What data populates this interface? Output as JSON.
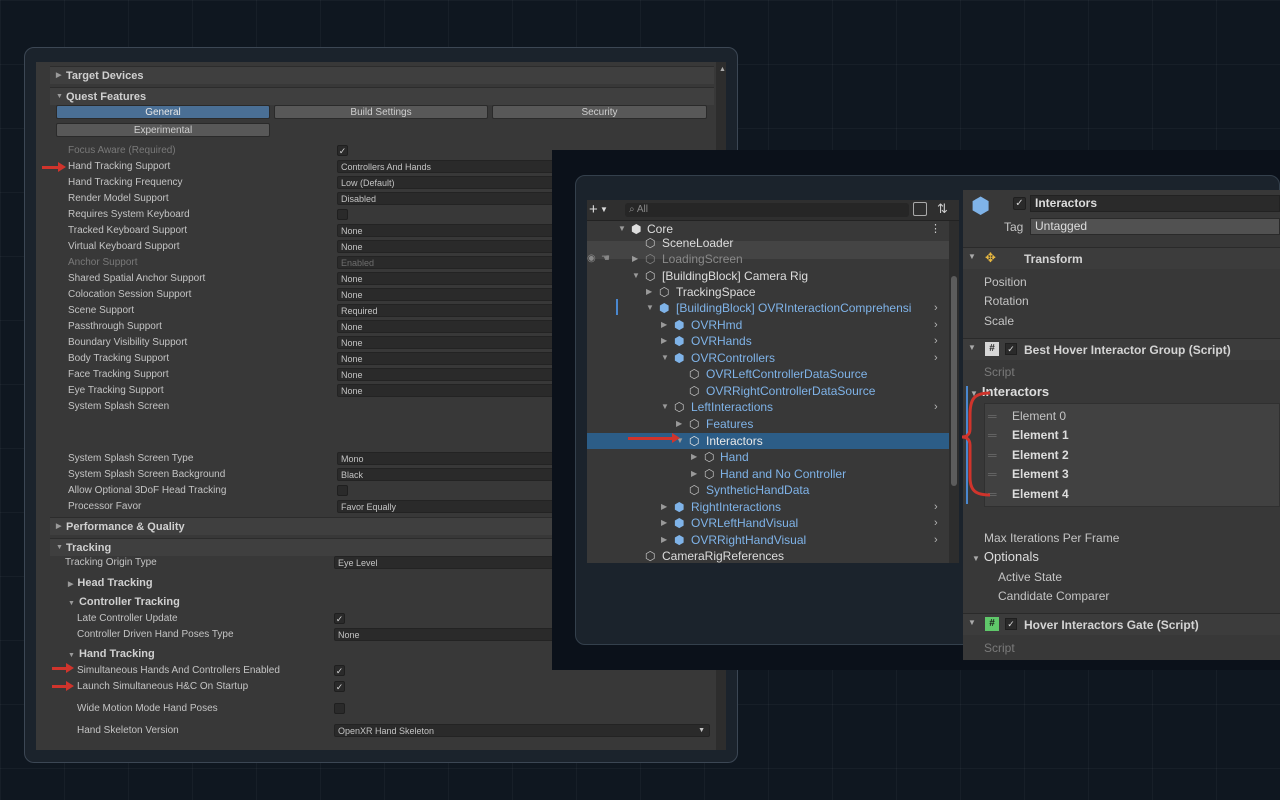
{
  "left": {
    "sections": {
      "target_devices": "Target Devices",
      "quest_features": "Quest Features",
      "performance": "Performance & Quality",
      "tracking": "Tracking"
    },
    "tabs": [
      "General",
      "Build Settings",
      "Security",
      "Experimental"
    ],
    "rows": [
      {
        "label": "Focus Aware (Required)",
        "check": "✓"
      },
      {
        "label": "Hand Tracking Support",
        "value": "Controllers And Hands"
      },
      {
        "label": "Hand Tracking Frequency",
        "value": "Low (Default)"
      },
      {
        "label": "Render Model Support",
        "value": "Disabled"
      },
      {
        "label": "Requires System Keyboard",
        "check": ""
      },
      {
        "label": "Tracked Keyboard Support",
        "value": "None"
      },
      {
        "label": "Virtual Keyboard Support",
        "value": "None"
      },
      {
        "label": "Anchor Support",
        "value": "Enabled"
      },
      {
        "label": "Shared Spatial Anchor Support",
        "value": "None"
      },
      {
        "label": "Colocation Session Support",
        "value": "None"
      },
      {
        "label": "Scene Support",
        "value": "Required"
      },
      {
        "label": "Passthrough Support",
        "value": "None"
      },
      {
        "label": "Boundary Visibility Support",
        "value": "None"
      },
      {
        "label": "Body Tracking Support",
        "value": "None"
      },
      {
        "label": "Face Tracking Support",
        "value": "None"
      },
      {
        "label": "Eye Tracking Support",
        "value": "None"
      },
      {
        "label": "System Splash Screen"
      },
      {
        "label": "System Splash Screen Type",
        "value": "Mono"
      },
      {
        "label": "System Splash Screen Background",
        "value": "Black"
      },
      {
        "label": "Allow Optional 3DoF Head Tracking",
        "check": ""
      },
      {
        "label": "Processor Favor",
        "value": "Favor Equally"
      }
    ],
    "tracking": {
      "origin_label": "Tracking Origin Type",
      "origin_value": "Eye Level",
      "head_tracking": "Head Tracking",
      "controller_tracking": "Controller Tracking",
      "late_update": "Late Controller Update",
      "late_update_check": "✓",
      "hand_poses": "Controller Driven Hand Poses Type",
      "hand_poses_value": "None",
      "hand_tracking": "Hand Tracking",
      "simul": "Simultaneous Hands And Controllers Enabled",
      "simul_check": "✓",
      "launch": "Launch Simultaneous H&C On Startup",
      "launch_check": "✓",
      "wide": "Wide Motion Mode Hand Poses",
      "wide_check": "",
      "skeleton": "Hand Skeleton Version",
      "skeleton_value": "OpenXR Hand Skeleton"
    }
  },
  "hierarchy": {
    "search_placeholder": "All",
    "add": "+",
    "items": [
      "Core",
      "SceneLoader",
      "LoadingScreen",
      "[BuildingBlock] Camera Rig",
      "TrackingSpace",
      "[BuildingBlock] OVRInteractionComprehensi",
      "OVRHmd",
      "OVRHands",
      "OVRControllers",
      "OVRLeftControllerDataSource",
      "OVRRightControllerDataSource",
      "LeftInteractions",
      "Features",
      "Interactors",
      "Hand",
      "Hand and No Controller",
      "SyntheticHandData",
      "RightInteractions",
      "OVRLeftHandVisual",
      "OVRRightHandVisual",
      "CameraRigReferences"
    ]
  },
  "inspector": {
    "object_name": "Interactors",
    "tag_label": "Tag",
    "tag_value": "Untagged",
    "transform": "Transform",
    "position": "Position",
    "rotation": "Rotation",
    "scale": "Scale",
    "best_hover": "Best Hover Interactor Group (Script)",
    "script": "Script",
    "interactors": "Interactors",
    "elements": [
      "Element 0",
      "Element 1",
      "Element 2",
      "Element 3",
      "Element 4"
    ],
    "max_iter": "Max Iterations Per Frame",
    "optionals": "Optionals",
    "active_state": "Active State",
    "candidate": "Candidate Comparer",
    "hover_gate": "Hover Interactors Gate (Script)",
    "script2": "Script"
  }
}
